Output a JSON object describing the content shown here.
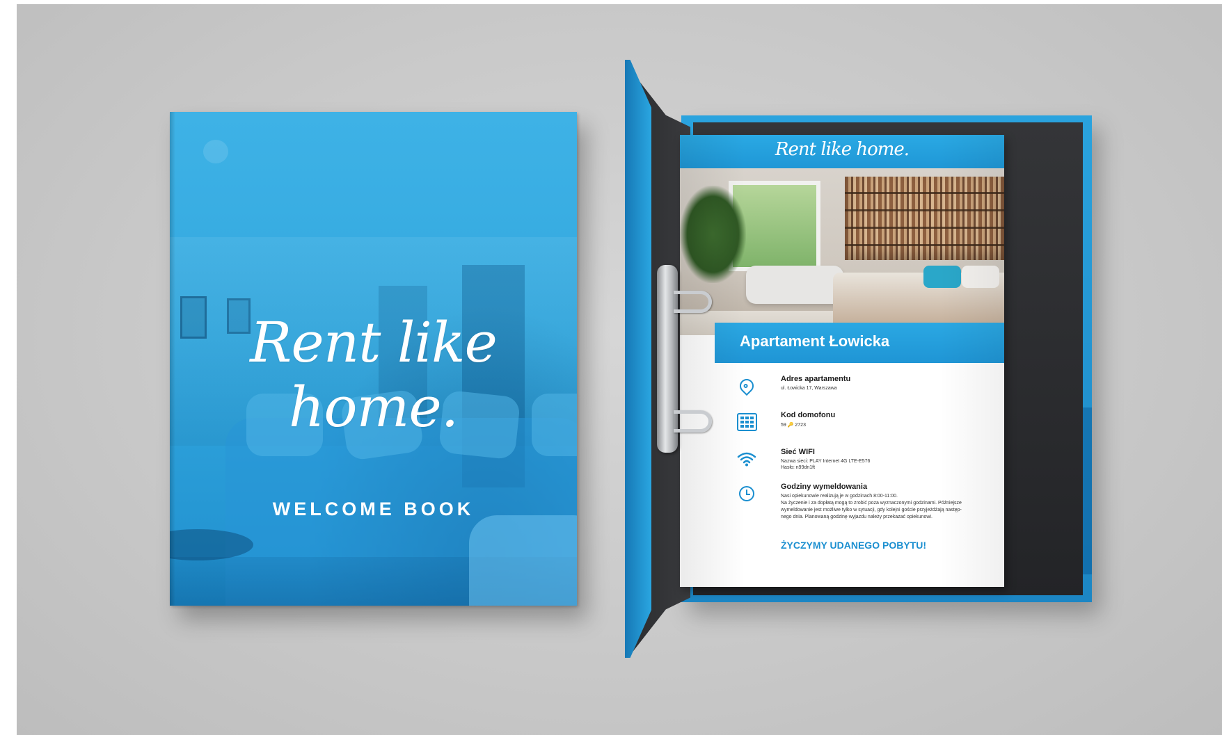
{
  "cover": {
    "brand": "Rent like home.",
    "subtitle": "WELCOME BOOK"
  },
  "sheet": {
    "brand": "Rent like home.",
    "title": "Apartament Łowicka",
    "sections": [
      {
        "icon": "map-pin-icon",
        "heading": "Adres apartamentu",
        "lines": [
          "ul. Łowicka 17, Warszawa"
        ]
      },
      {
        "icon": "keypad-icon",
        "heading": "Kod domofonu",
        "lines": [
          "59 🔑 2723"
        ]
      },
      {
        "icon": "wifi-icon",
        "heading": "Sieć WIFI",
        "lines": [
          "Nazwa sieci: PLAY Internet 4G LTE-E576",
          "Hasło: n99dn1ft"
        ]
      },
      {
        "icon": "clock-icon",
        "heading": "Godziny wymeldowania",
        "lines": [
          "Nasi opiekunowie realizują je w godzinach 8:00-11:00.",
          "Na życzenie i za dopłatą mogą to zrobić poza wyznaczonymi godzinami. Późniejsze",
          "wymeldowanie jest możliwe tylko w sytuacji, gdy kolejni goście przyjeżdżają następ-",
          "nego dnia.  Planowaną godzinę wyjazdu należy przekazać opiekunowi."
        ]
      }
    ],
    "closing": "ŻYCZYMY UDANEGO POBYTU!"
  },
  "colors": {
    "brand_blue": "#2aa9e4",
    "accent_blue": "#1b8fd0",
    "binder_inner": "#2a2b2e",
    "background": "#c9c9c9"
  }
}
